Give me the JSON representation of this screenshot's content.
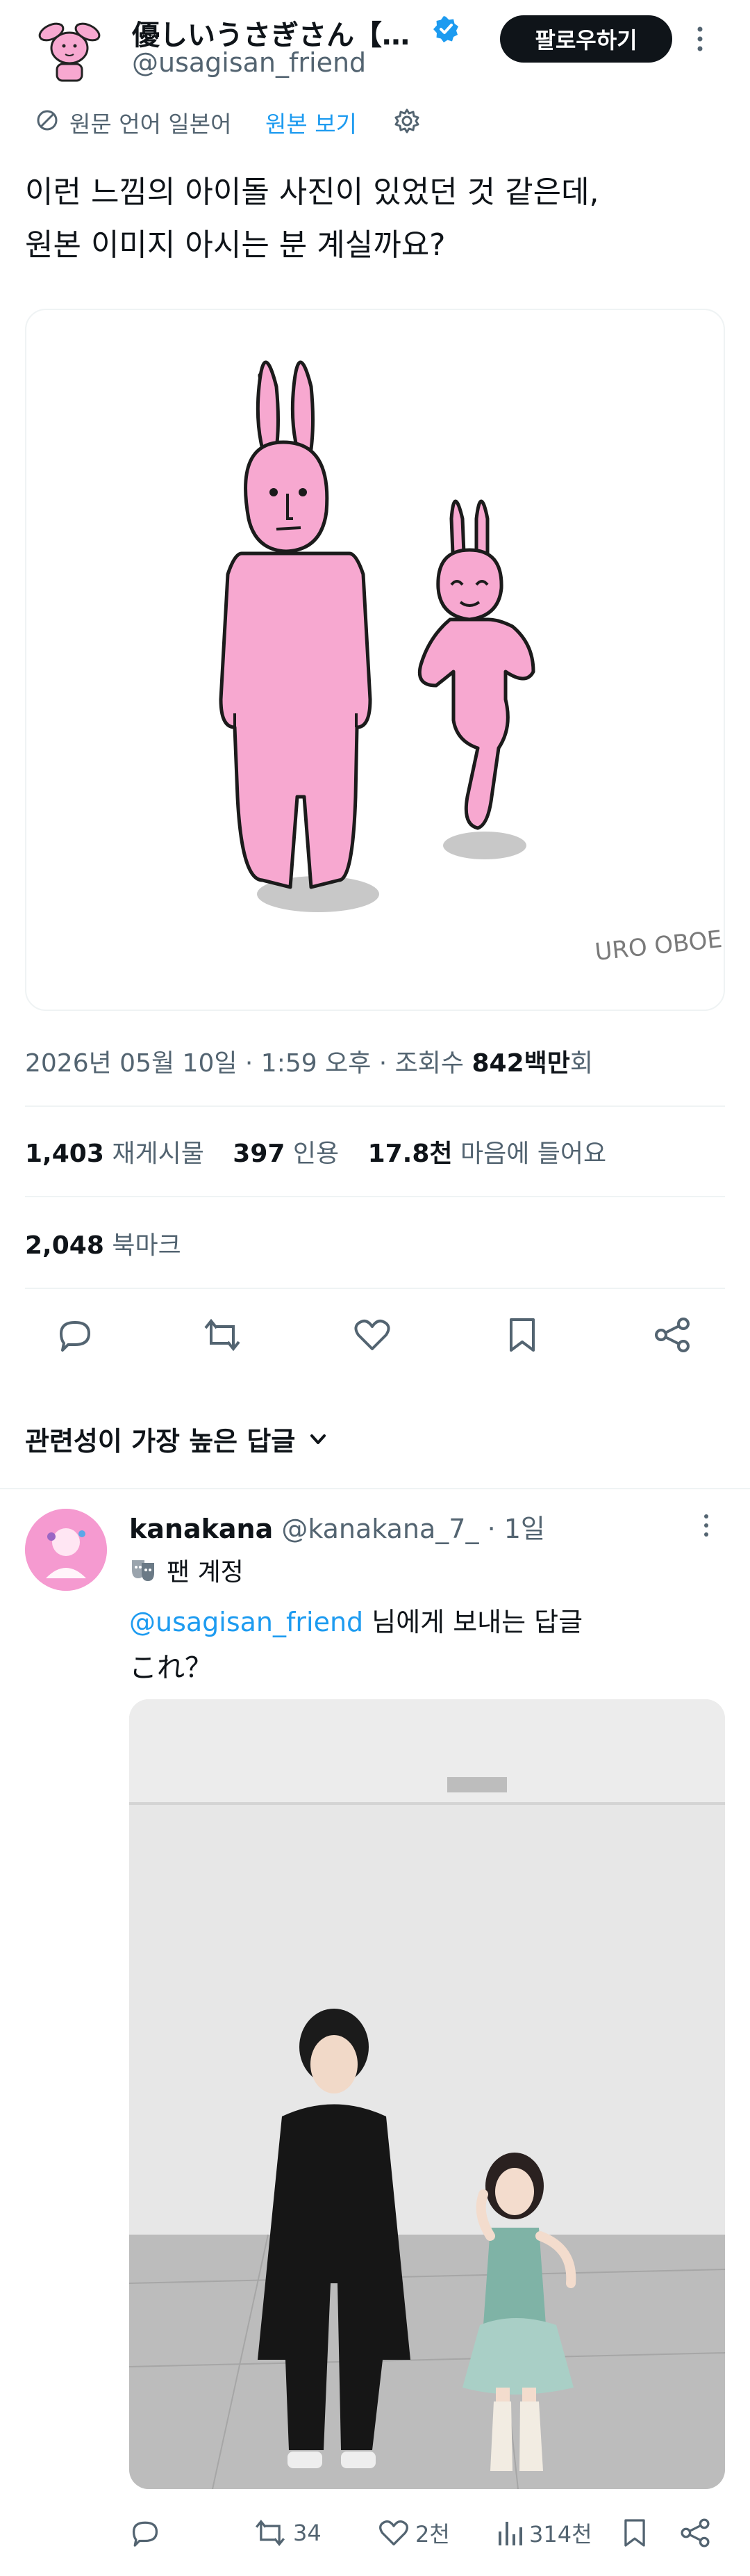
{
  "author": {
    "name": "優しいうさぎさん【…",
    "handle": "@usagisan_friend",
    "follow_label": "팔로우하기"
  },
  "translate_bar": {
    "original_language": "원문 언어 일본어",
    "view_original": "원본 보기"
  },
  "post": {
    "text_line1": "이런 느낌의 아이돌 사진이 있었던 것 같은데,",
    "text_line2": "원본 이미지 아시는 분 계실까요?",
    "image_signature": "URO OBOE…",
    "meta_date": "2026년 05월 10일 · 1:59 오후 · 조회수 ",
    "meta_views": "842백만",
    "meta_suffix": "회"
  },
  "stats": {
    "retweets_count": "1,403",
    "retweets_label": "재게시물",
    "quotes_count": "397",
    "quotes_label": "인용",
    "likes_count": "17.8천",
    "likes_label": "마음에 들어요",
    "bookmarks_count": "2,048",
    "bookmarks_label": "북마크"
  },
  "actions": [
    "reply-icon",
    "retweet-icon",
    "like-icon",
    "bookmark-icon",
    "share-icon"
  ],
  "sort": {
    "label": "관련성이 가장 높은 답글"
  },
  "reply": {
    "name": "kanakana",
    "handle": "@kanakana_7_",
    "time": "· 1일",
    "badge": "팬 계정",
    "replying_to_handle": "@usagisan_friend",
    "replying_to_suffix": " 님에게 보내는 답글",
    "text": "これ？",
    "retweets": "34",
    "likes": "2천",
    "views": "314천"
  },
  "colors": {
    "accent": "#1d9bf0",
    "bunny_pink": "#f7a8d0",
    "follow_bg": "#0f1419"
  }
}
